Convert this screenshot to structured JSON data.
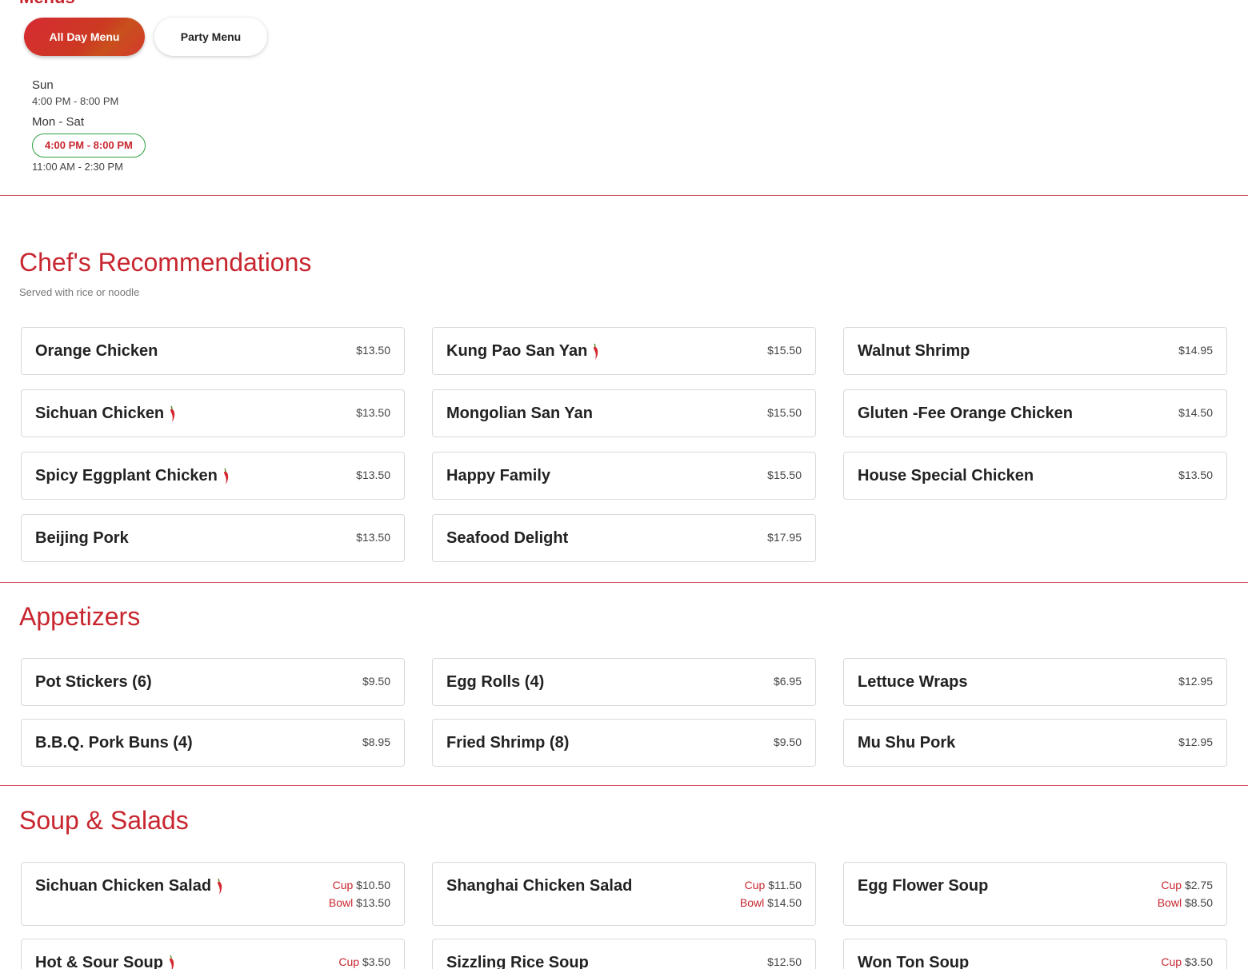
{
  "menus_heading": "Menus",
  "tabs": [
    {
      "label": "All Day Menu",
      "active": true
    },
    {
      "label": "Party Menu",
      "active": false
    }
  ],
  "hours": {
    "block1": {
      "day": "Sun",
      "time": "4:00 PM - 8:00 PM"
    },
    "block2": {
      "day": "Mon - Sat",
      "time_highlight": "4:00 PM - 8:00 PM",
      "time": "11:00 AM - 2:30 PM"
    }
  },
  "colors": {
    "accent": "#c8262f",
    "highlight_border": "#2e9e3e"
  },
  "sections": {
    "chefs": {
      "title": "Chef's Recommendations",
      "subtitle": "Served with rice or noodle",
      "items": [
        {
          "name": "Orange Chicken",
          "price": "$13.50",
          "spicy": false
        },
        {
          "name": "Kung Pao San Yan",
          "price": "$15.50",
          "spicy": true
        },
        {
          "name": "Walnut Shrimp",
          "price": "$14.95",
          "spicy": false
        },
        {
          "name": "Sichuan Chicken",
          "price": "$13.50",
          "spicy": true
        },
        {
          "name": "Mongolian San Yan",
          "price": "$15.50",
          "spicy": false
        },
        {
          "name": "Gluten -Fee Orange Chicken",
          "price": "$14.50",
          "spicy": false
        },
        {
          "name": "Spicy Eggplant Chicken",
          "price": "$13.50",
          "spicy": true
        },
        {
          "name": "Happy Family",
          "price": "$15.50",
          "spicy": false
        },
        {
          "name": "House Special Chicken",
          "price": "$13.50",
          "spicy": false
        },
        {
          "name": "Beijing Pork",
          "price": "$13.50",
          "spicy": false
        },
        {
          "name": "Seafood Delight",
          "price": "$17.95",
          "spicy": false
        }
      ]
    },
    "appetizers": {
      "title": "Appetizers",
      "items": [
        {
          "name": "Pot Stickers (6)",
          "price": "$9.50"
        },
        {
          "name": "Egg Rolls (4)",
          "price": "$6.95"
        },
        {
          "name": "Lettuce Wraps",
          "price": "$12.95"
        },
        {
          "name": "B.B.Q. Pork Buns (4)",
          "price": "$8.95"
        },
        {
          "name": "Fried Shrimp (8)",
          "price": "$9.50"
        },
        {
          "name": "Mu Shu Pork",
          "price": "$12.95"
        }
      ]
    },
    "soups": {
      "title": "Soup & Salads",
      "cup_label": "Cup",
      "bowl_label": "Bowl",
      "items": [
        {
          "name": "Sichuan Chicken Salad",
          "spicy": true,
          "cup": "$10.50",
          "bowl": "$13.50"
        },
        {
          "name": "Shanghai Chicken Salad",
          "spicy": false,
          "cup": "$11.50",
          "bowl": "$14.50"
        },
        {
          "name": "Egg Flower Soup",
          "spicy": false,
          "cup": "$2.75",
          "bowl": "$8.50"
        },
        {
          "name": "Hot & Sour Soup",
          "spicy": true,
          "cup": "$3.50"
        },
        {
          "name": "Sizzling Rice Soup",
          "spicy": false,
          "price": "$12.50"
        },
        {
          "name": "Won Ton Soup",
          "spicy": false,
          "cup": "$3.50"
        }
      ]
    }
  }
}
